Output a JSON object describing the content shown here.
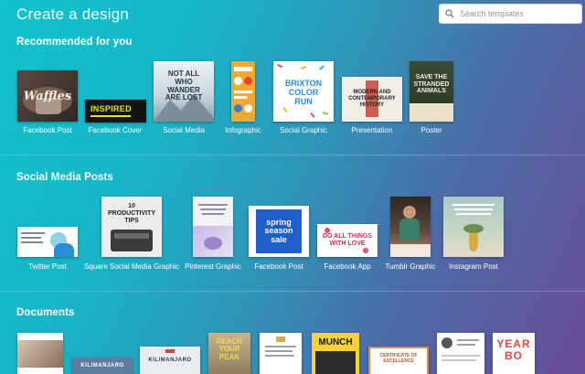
{
  "header": {
    "title": "Create a design",
    "search_placeholder": "Search templates"
  },
  "sections": {
    "recommended": {
      "title": "Recommended for you",
      "items": [
        {
          "label": "Facebook Post",
          "thumb_text": "Waffles"
        },
        {
          "label": "Facebook Cover",
          "thumb_text": "INSPIRED"
        },
        {
          "label": "Social Media",
          "thumb_text": "NOT ALL WHO WANDER ARE LOST"
        },
        {
          "label": "Infographic",
          "thumb_text": ""
        },
        {
          "label": "Social Graphic",
          "thumb_text": "BRIXTON COLOR RUN"
        },
        {
          "label": "Presentation",
          "thumb_text": "MODERN AND CONTEMPORARY HISTORY"
        },
        {
          "label": "Poster",
          "thumb_text": "SAVE THE STRANDED ANIMALS"
        }
      ]
    },
    "social": {
      "title": "Social Media Posts",
      "items": [
        {
          "label": "Twitter Post",
          "thumb_text": ""
        },
        {
          "label": "Square Social Media Graphic",
          "thumb_text": "10 PRODUCTIVITY TIPS"
        },
        {
          "label": "Pinterest Graphic",
          "thumb_text": ""
        },
        {
          "label": "Facebook Post",
          "thumb_text": "spring season sale"
        },
        {
          "label": "Facebook App",
          "thumb_text": "DO ALL THINGS WITH LOVE"
        },
        {
          "label": "Tumblr Graphic",
          "thumb_text": ""
        },
        {
          "label": "Instagram Post",
          "thumb_text": ""
        }
      ]
    },
    "documents": {
      "title": "Documents",
      "items": [
        {
          "thumb_text": ""
        },
        {
          "thumb_text": "KILIMANJARO"
        },
        {
          "thumb_text": "KILIMANJARO"
        },
        {
          "thumb_text": "REACH YOUR PEAK"
        },
        {
          "thumb_text": ""
        },
        {
          "thumb_text": "MUNCH"
        },
        {
          "thumb_text": "CERTIFICATE OF EXCELLENCE"
        },
        {
          "thumb_text": ""
        },
        {
          "thumb_text": "YEAR BO"
        }
      ]
    }
  },
  "colors": {
    "bg_start": "#12c2cc",
    "bg_end": "#6a4c98",
    "text": "#ffffff"
  }
}
